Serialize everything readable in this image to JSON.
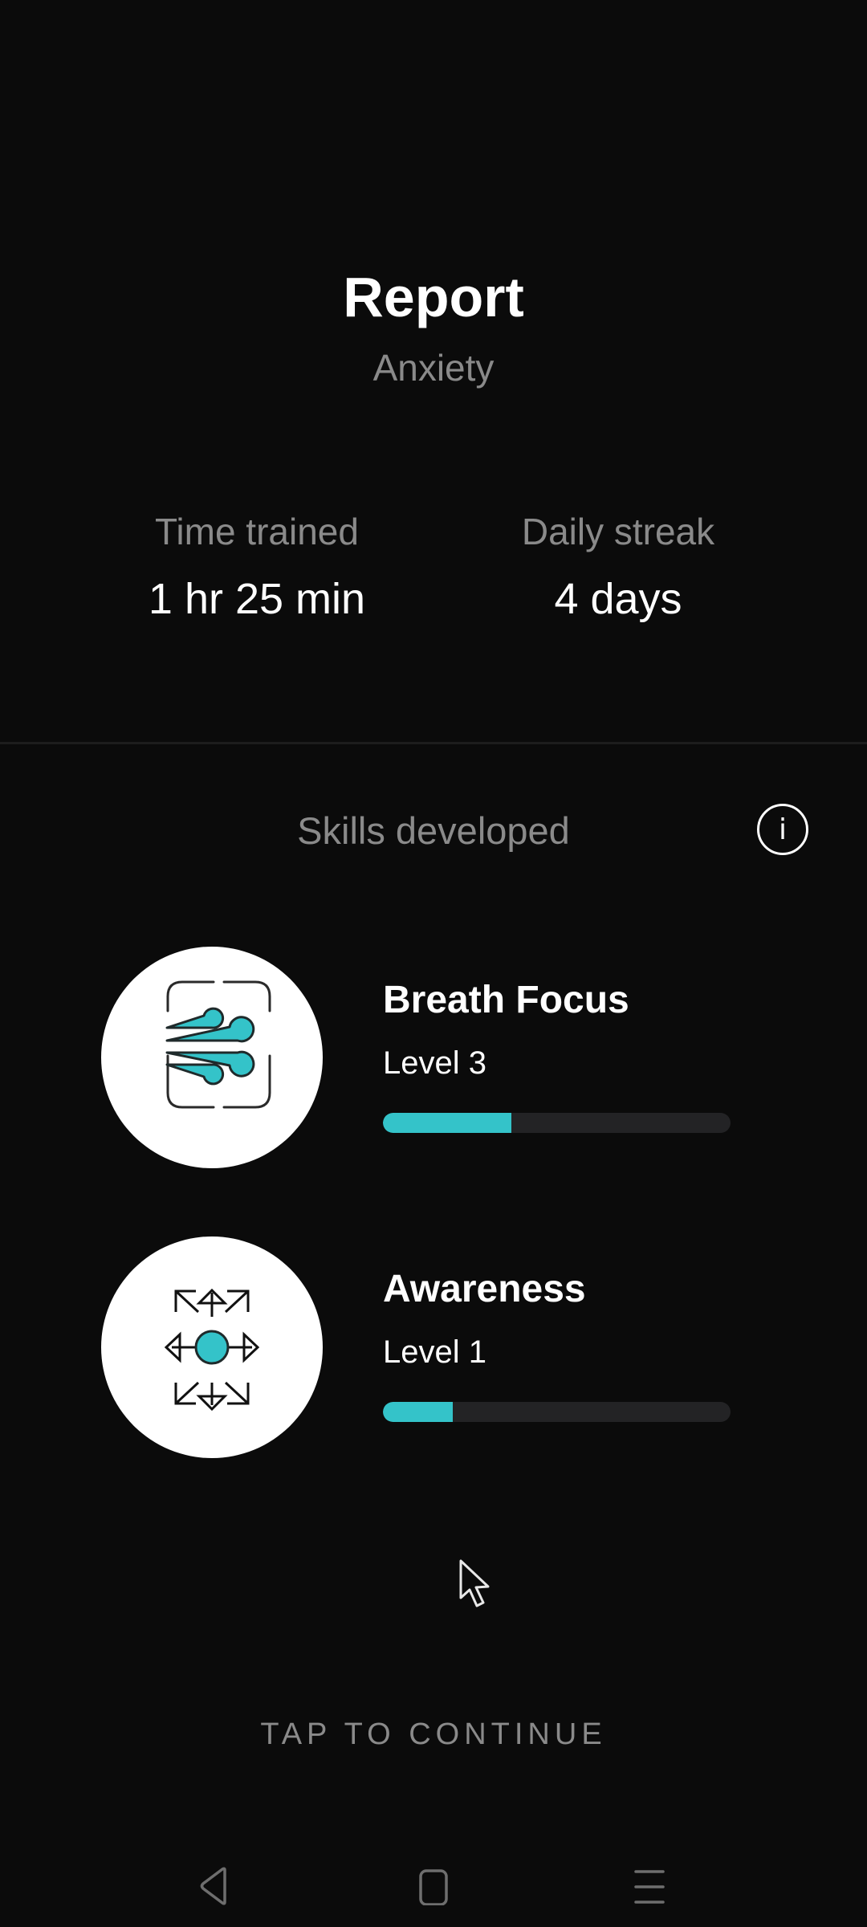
{
  "header": {
    "title": "Report",
    "subtitle": "Anxiety"
  },
  "stats": [
    {
      "label": "Time trained",
      "value": "1 hr 25 min"
    },
    {
      "label": "Daily streak",
      "value": "4 days"
    }
  ],
  "skills_section": {
    "heading": "Skills developed",
    "info_icon": "info-circle-icon"
  },
  "skills": [
    {
      "name": "Breath Focus",
      "level": "Level 3",
      "progress_percent": 37,
      "icon": "wind-breath-icon"
    },
    {
      "name": "Awareness",
      "level": "Level 1",
      "progress_percent": 20,
      "icon": "arrows-outward-icon"
    }
  ],
  "footer": {
    "continue_label": "TAP TO CONTINUE"
  },
  "nav_bar": {
    "back_icon": "back-triangle-icon",
    "home_icon": "home-square-icon",
    "menu_icon": "menu-lines-icon"
  },
  "colors": {
    "background": "#0b0b0b",
    "accent": "#34c3c9",
    "muted_text": "#8a8a8a",
    "bar_track": "#232325"
  }
}
